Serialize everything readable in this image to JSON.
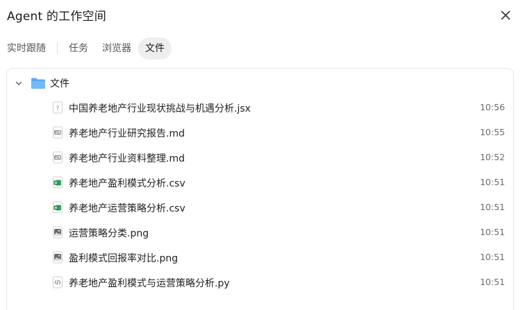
{
  "window": {
    "title": "Agent 的工作空间"
  },
  "tabs": [
    {
      "label": "实时跟随"
    },
    {
      "label": "任务"
    },
    {
      "label": "浏览器"
    },
    {
      "label": "文件"
    }
  ],
  "folder": {
    "label": "文件"
  },
  "files": [
    {
      "name": "中国养老地产行业现状挑战与机遇分析.jsx",
      "time": "10:56",
      "icon": "unknown-file-icon"
    },
    {
      "name": "养老地产行业研究报告.md",
      "time": "10:55",
      "icon": "markdown-file-icon"
    },
    {
      "name": "养老地产行业资料整理.md",
      "time": "10:52",
      "icon": "markdown-file-icon"
    },
    {
      "name": "养老地产盈利模式分析.csv",
      "time": "10:51",
      "icon": "spreadsheet-file-icon"
    },
    {
      "name": "养老地产运营策略分析.csv",
      "time": "10:51",
      "icon": "spreadsheet-file-icon"
    },
    {
      "name": "运营策略分类.png",
      "time": "10:51",
      "icon": "image-file-icon"
    },
    {
      "name": "盈利模式回报率对比.png",
      "time": "10:51",
      "icon": "image-file-icon"
    },
    {
      "name": "养老地产盈利模式与运营策略分析.py",
      "time": "10:51",
      "icon": "code-file-icon"
    }
  ],
  "colors": {
    "folder": "#5aaaf5",
    "spreadsheet": "#1f8a4c",
    "active_tab_bg": "#eeeeef"
  }
}
